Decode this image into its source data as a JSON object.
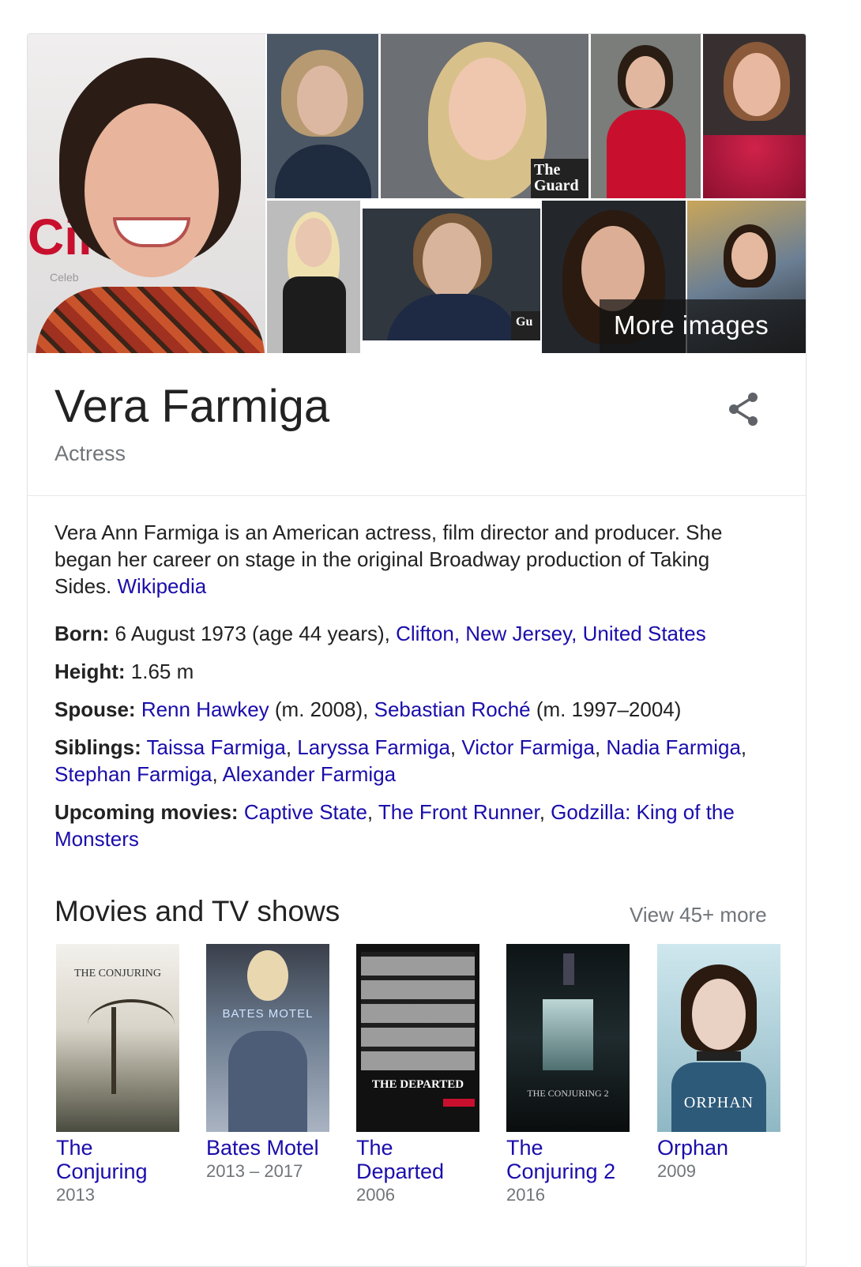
{
  "images": {
    "more_label": "More images",
    "watermark_1": "The Guard",
    "watermark_2": "Gu",
    "poster_caption_1": "Cine",
    "poster_caption_2": "Celeb"
  },
  "entity": {
    "name": "Vera Farmiga",
    "type": "Actress"
  },
  "description": {
    "text": "Vera Ann Farmiga is an American actress, film director and producer. She began her career on stage in the original Broadway production of Taking Sides.",
    "source": "Wikipedia"
  },
  "facts": {
    "born_label": "Born:",
    "born_text": " 6 August 1973 (age 44 years), ",
    "born_place": "Clifton, New Jersey, United States",
    "height_label": "Height:",
    "height_value": " 1.65 m",
    "spouse_label": "Spouse:",
    "spouse_1": "Renn Hawkey",
    "spouse_1_years": " (m. 2008), ",
    "spouse_2": "Sebastian Roché",
    "spouse_2_years": " (m. 1997–2004)",
    "siblings_label": "Siblings:",
    "siblings": [
      "Taissa Farmiga",
      "Laryssa Farmiga",
      "Victor Farmiga",
      "Nadia Farmiga",
      "Stephan Farmiga",
      "Alexander Farmiga"
    ],
    "upcoming_label": "Upcoming movies:",
    "upcoming": [
      "Captive State",
      "The Front Runner",
      "Godzilla: King of the Monsters"
    ]
  },
  "movies_section": {
    "title": "Movies and TV shows",
    "view_more": "View 45+ more",
    "items": [
      {
        "name": "The Conjuring",
        "year": "2013",
        "poster_text": "THE CONJURING"
      },
      {
        "name": "Bates Motel",
        "year": "2013 – 2017",
        "poster_text": "BATES MOTEL"
      },
      {
        "name": "The Departed",
        "year": "2006",
        "poster_text": "THE DEPARTED"
      },
      {
        "name": "The Conjuring 2",
        "year": "2016",
        "poster_text": "THE CONJURING 2"
      },
      {
        "name": "Orphan",
        "year": "2009",
        "poster_text": "ORPHAN"
      }
    ]
  }
}
